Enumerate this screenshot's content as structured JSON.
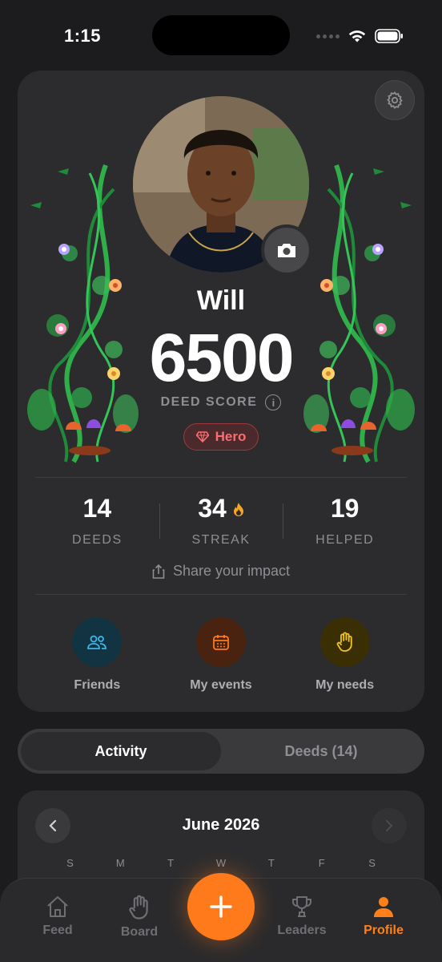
{
  "status_bar": {
    "time": "1:15"
  },
  "profile": {
    "name": "Will",
    "deed_score": "6500",
    "deed_score_label": "DEED SCORE",
    "info_symbol": "i",
    "badge": {
      "label": "Hero",
      "icon": "gem-icon",
      "color": "#ff6b6e"
    },
    "settings_icon": "gear-icon",
    "camera_icon": "camera-icon"
  },
  "stats": [
    {
      "value": "14",
      "label": "DEEDS"
    },
    {
      "value": "34",
      "label": "STREAK",
      "icon": "flame-icon",
      "icon_color": "#f5a623"
    },
    {
      "value": "19",
      "label": "HELPED"
    }
  ],
  "share": {
    "label": "Share your impact",
    "icon": "share-icon"
  },
  "quick_actions": [
    {
      "label": "Friends",
      "icon": "people-icon",
      "color": "#3ab7e8",
      "bg": "#123341"
    },
    {
      "label": "My events",
      "icon": "calendar-icon",
      "color": "#ff7a1a",
      "bg": "#4a2210"
    },
    {
      "label": "My needs",
      "icon": "hand-icon",
      "color": "#f5c518",
      "bg": "#3a2e05"
    }
  ],
  "segmented": {
    "tabs": [
      "Activity",
      "Deeds (14)"
    ],
    "active": "Activity"
  },
  "calendar": {
    "month_label": "June 2026",
    "weekdays": [
      "S",
      "M",
      "T",
      "W",
      "T",
      "F",
      "S"
    ]
  },
  "tab_bar": {
    "tabs": [
      {
        "label": "Feed",
        "icon": "home-icon"
      },
      {
        "label": "Board",
        "icon": "hand-icon"
      },
      {
        "label": "Leaders",
        "icon": "trophy-icon"
      },
      {
        "label": "Profile",
        "icon": "person-icon",
        "active": true
      }
    ],
    "fab_icon": "plus-icon",
    "accent": "#ff7a1a"
  }
}
